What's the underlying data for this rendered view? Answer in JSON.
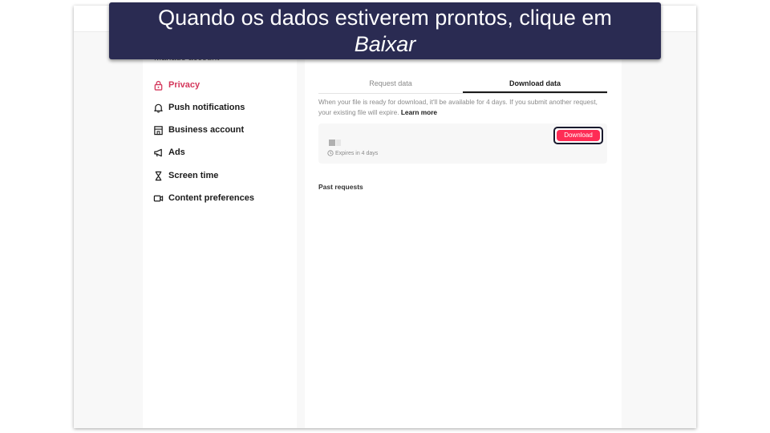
{
  "caption": {
    "text": "Quando os dados estiverem prontos, clique em",
    "emphasis": "Baixar"
  },
  "sidebar": {
    "cut_item": "Manage account",
    "items": [
      {
        "label": "Privacy",
        "icon": "lock-icon",
        "active": true
      },
      {
        "label": "Push notifications",
        "icon": "bell-icon"
      },
      {
        "label": "Business account",
        "icon": "store-icon"
      },
      {
        "label": "Ads",
        "icon": "megaphone-icon"
      },
      {
        "label": "Screen time",
        "icon": "hourglass-icon"
      },
      {
        "label": "Content preferences",
        "icon": "video-icon"
      }
    ]
  },
  "main": {
    "tabs": [
      {
        "label": "Request data",
        "active": false
      },
      {
        "label": "Download data",
        "active": true
      }
    ],
    "description": "When your file is ready for download, it'll be available for 4 days. If you submit another request, your existing file will expire.",
    "learn_more": "Learn more",
    "file": {
      "expires": "Expires in 4 days",
      "download_label": "Download"
    },
    "past_requests": "Past requests"
  },
  "colors": {
    "accent": "#fe2c55",
    "active_nav": "#d4375b",
    "caption_bg": "#2a2b52"
  }
}
